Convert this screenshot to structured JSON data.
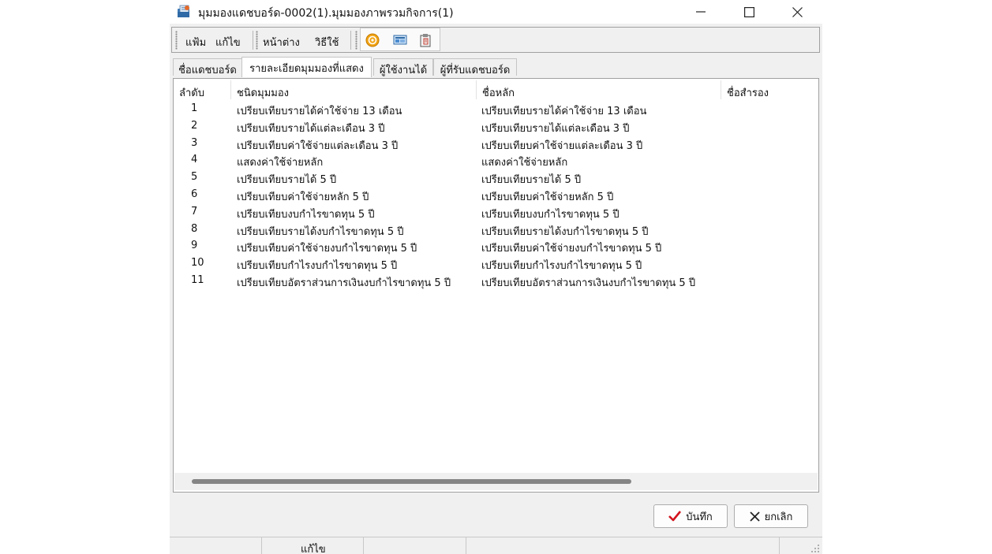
{
  "window": {
    "title": "มุมมองแดชบอร์ด-0002(1).มุมมองภาพรวมกิจการ(1)",
    "title_icon": "app-folder-icon"
  },
  "window_controls": [
    "minimize-icon",
    "maximize-icon",
    "close-icon"
  ],
  "menu": {
    "file": "แฟ้ม",
    "edit": "แก้ไข",
    "window": "หน้าต่าง",
    "howto": "วิธีใช้"
  },
  "toolbar_icons": [
    "help-circle-icon",
    "screen-icon",
    "clipboard-icon"
  ],
  "tabs": [
    {
      "label": "ชื่อแดชบอร์ด",
      "active": false
    },
    {
      "label": "รายละเอียดมุมมองที่แสดง",
      "active": true
    },
    {
      "label": "ผู้ใช้งานได้",
      "active": false
    },
    {
      "label": "ผู้ที่รับแดชบอร์ด",
      "active": false
    }
  ],
  "table": {
    "columns": [
      "ลำดับ",
      "ชนิดมุมมอง",
      "ชื่อหลัก",
      "ชื่อสำรอง"
    ],
    "rows": [
      [
        "1",
        "เปรียบเทียบรายได้ค่าใช้จ่าย  13 เดือน",
        "เปรียบเทียบรายได้ค่าใช้จ่าย  13 เดือน",
        ""
      ],
      [
        "2",
        "เปรียบเทียบรายได้แต่ละเดือน 3 ปี",
        "เปรียบเทียบรายได้แต่ละเดือน 3 ปี",
        ""
      ],
      [
        "3",
        "เปรียบเทียบค่าใช้จ่ายแต่ละเดือน 3 ปี",
        "เปรียบเทียบค่าใช้จ่ายแต่ละเดือน 3 ปี",
        ""
      ],
      [
        "4",
        "แสดงค่าใช้จ่ายหลัก",
        "แสดงค่าใช้จ่ายหลัก",
        ""
      ],
      [
        "5",
        "เปรียบเทียบรายได้ 5 ปี",
        "เปรียบเทียบรายได้ 5 ปี",
        ""
      ],
      [
        "6",
        "เปรียบเทียบค่าใช้จ่ายหลัก 5 ปี",
        "เปรียบเทียบค่าใช้จ่ายหลัก 5 ปี",
        ""
      ],
      [
        "7",
        "เปรียบเทียบงบกำไรขาดทุน 5 ปี",
        "เปรียบเทียบงบกำไรขาดทุน 5 ปี",
        ""
      ],
      [
        "8",
        "เปรียบเทียบรายได้งบกำไรขาดทุน 5 ปี",
        "เปรียบเทียบรายได้งบกำไรขาดทุน 5 ปี",
        ""
      ],
      [
        "9",
        "เปรียบเทียบค่าใช้จ่ายงบกำไรขาดทุน 5 ปี",
        "เปรียบเทียบค่าใช้จ่ายงบกำไรขาดทุน 5 ปี",
        ""
      ],
      [
        "10",
        "เปรียบเทียบกำไรงบกำไรขาดทุน 5 ปี",
        "เปรียบเทียบกำไรงบกำไรขาดทุน 5 ปี",
        ""
      ],
      [
        "11",
        "เปรียบเทียบอัตราส่วนการเงินงบกำไรขาดทุน 5 ปี",
        "เปรียบเทียบอัตราส่วนการเงินงบกำไรขาดทุน 5 ปี",
        ""
      ]
    ]
  },
  "buttons": {
    "save": "บันทึก",
    "cancel": "ยกเลิก"
  },
  "status": {
    "mode": "แก้ไข"
  },
  "colors": {
    "check_red": "#d2141e",
    "window_bg": "#f0f0f0"
  }
}
